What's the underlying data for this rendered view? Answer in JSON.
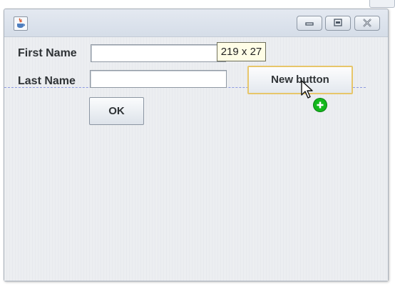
{
  "window": {
    "controls": [
      "minimize",
      "maximize",
      "close"
    ]
  },
  "form": {
    "first_name_label": "First Name",
    "first_name_value": "",
    "last_name_label": "Last Name",
    "last_name_value": "",
    "ok_label": "OK",
    "new_button_label": "New button"
  },
  "designer": {
    "size_tooltip": "219 x 27"
  },
  "icons": {
    "app": "java-app-icon",
    "minimize": "minimize-icon",
    "maximize": "maximize-icon",
    "close": "close-icon",
    "cursor": "mouse-pointer-icon",
    "add": "add-plus-icon"
  },
  "colors": {
    "selection_border": "#e7c66a",
    "guide_line": "#8c9ae0",
    "add_badge": "#13b81c"
  }
}
